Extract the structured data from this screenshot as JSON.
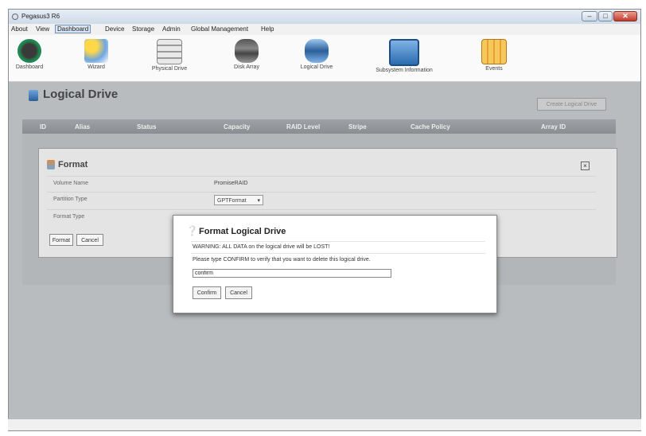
{
  "window": {
    "title": "Pegasus3 R6"
  },
  "menu": [
    "About",
    "View",
    "Dashboard",
    "Device",
    "Storage",
    "Admin",
    "Global Management",
    "Help"
  ],
  "toolbar": [
    {
      "label": "Dashboard",
      "icon": "dashboard-gauge-icon"
    },
    {
      "label": "Wizard",
      "icon": "wizard-icon"
    },
    {
      "label": "Physical Drive",
      "icon": "physical-drive-icon"
    },
    {
      "label": "Disk Array",
      "icon": "disk-array-icon"
    },
    {
      "label": "Logical Drive",
      "icon": "logical-drive-icon"
    },
    {
      "label": "Subsystem Information",
      "icon": "subsystem-info-icon"
    },
    {
      "label": "Events",
      "icon": "events-icon"
    }
  ],
  "page": {
    "title": "Logical Drive",
    "create_button": "Create Logical Drive"
  },
  "table": {
    "columns": [
      "ID",
      "Alias",
      "Status",
      "Capacity",
      "RAID Level",
      "Stripe",
      "Cache Policy",
      "Array ID"
    ]
  },
  "format": {
    "title": "Format",
    "volume_name_label": "Volume Name",
    "volume_name_value": "PromiseRAID",
    "partition_type_label": "Partition Type",
    "partition_type_value": "GPTFormat",
    "format_type_label": "Format Type",
    "format_button": "Format",
    "cancel_button": "Cancel"
  },
  "dialog": {
    "title": "Format Logical Drive",
    "warning": "WARNING: ALL DATA on the logical drive will be LOST!",
    "prompt": "Please type CONFIRM to verify that you want to delete this logical drive.",
    "input_value": "confirm",
    "confirm_button": "Confirm",
    "cancel_button": "Cancel"
  },
  "colors": {
    "accent": "#2b6cb0",
    "close": "#c0392b"
  }
}
